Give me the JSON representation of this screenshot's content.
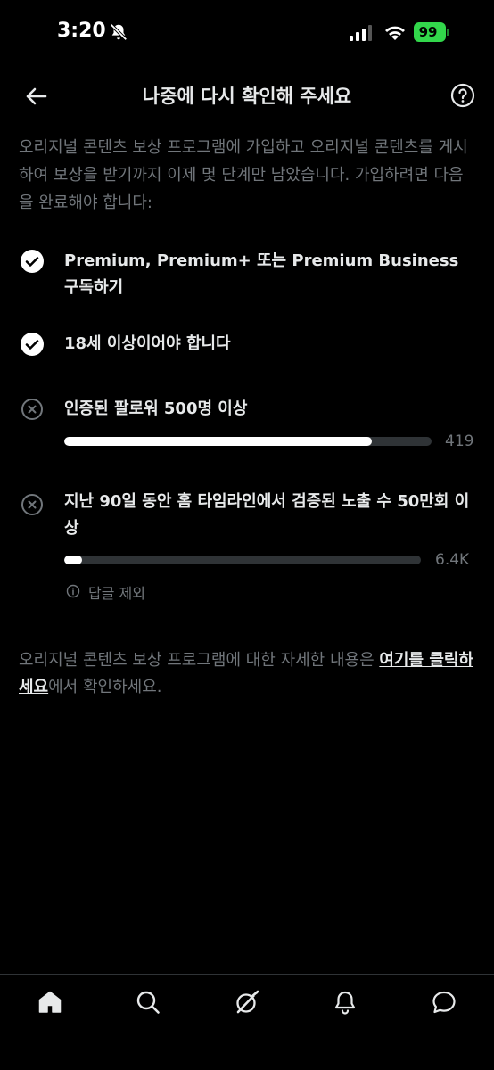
{
  "status_bar": {
    "time": "3:20",
    "battery_level": "99",
    "battery_color": "#32d74b"
  },
  "header": {
    "title": "나중에 다시 확인해 주세요",
    "back_icon": "arrow-left-icon",
    "help_icon": "question-circle-icon"
  },
  "intro": "오리지널 콘텐츠 보상 프로그램에 가입하고 오리지널 콘텐츠를 게시하여 보상을 받기까지 이제 몇 단계만 남았습니다. 가입하려면 다음을 완료해야 합니다:",
  "requirements": [
    {
      "label": "Premium, Premium+ 또는 Premium Business 구독하기",
      "status": "complete",
      "icon": "check-circle-icon"
    },
    {
      "label": "18세 이상이어야 합니다",
      "status": "complete",
      "icon": "check-circle-icon"
    },
    {
      "label": "인증된 팔로워 500명 이상",
      "status": "incomplete",
      "icon": "x-circle-icon",
      "progress_value": "419",
      "progress_fraction": 0.838
    },
    {
      "label": "지난 90일 동안 홈 타임라인에서 검증된 노출 수 50만회 이상",
      "status": "incomplete",
      "icon": "x-circle-icon",
      "progress_value": "6.4K",
      "progress_fraction": 0.05
    }
  ],
  "note": "답글 제외",
  "footer": {
    "text_before": "오리지널 콘텐츠 보상 프로그램에 대한 자세한 내용은 ",
    "link": "여기를 클릭하세요",
    "text_after": "에서 확인하세요."
  },
  "bottom_nav": [
    {
      "name": "home",
      "icon": "home-icon"
    },
    {
      "name": "search",
      "icon": "search-icon"
    },
    {
      "name": "grok",
      "icon": "grok-icon"
    },
    {
      "name": "notifications",
      "icon": "bell-icon"
    },
    {
      "name": "messages",
      "icon": "message-icon"
    }
  ]
}
